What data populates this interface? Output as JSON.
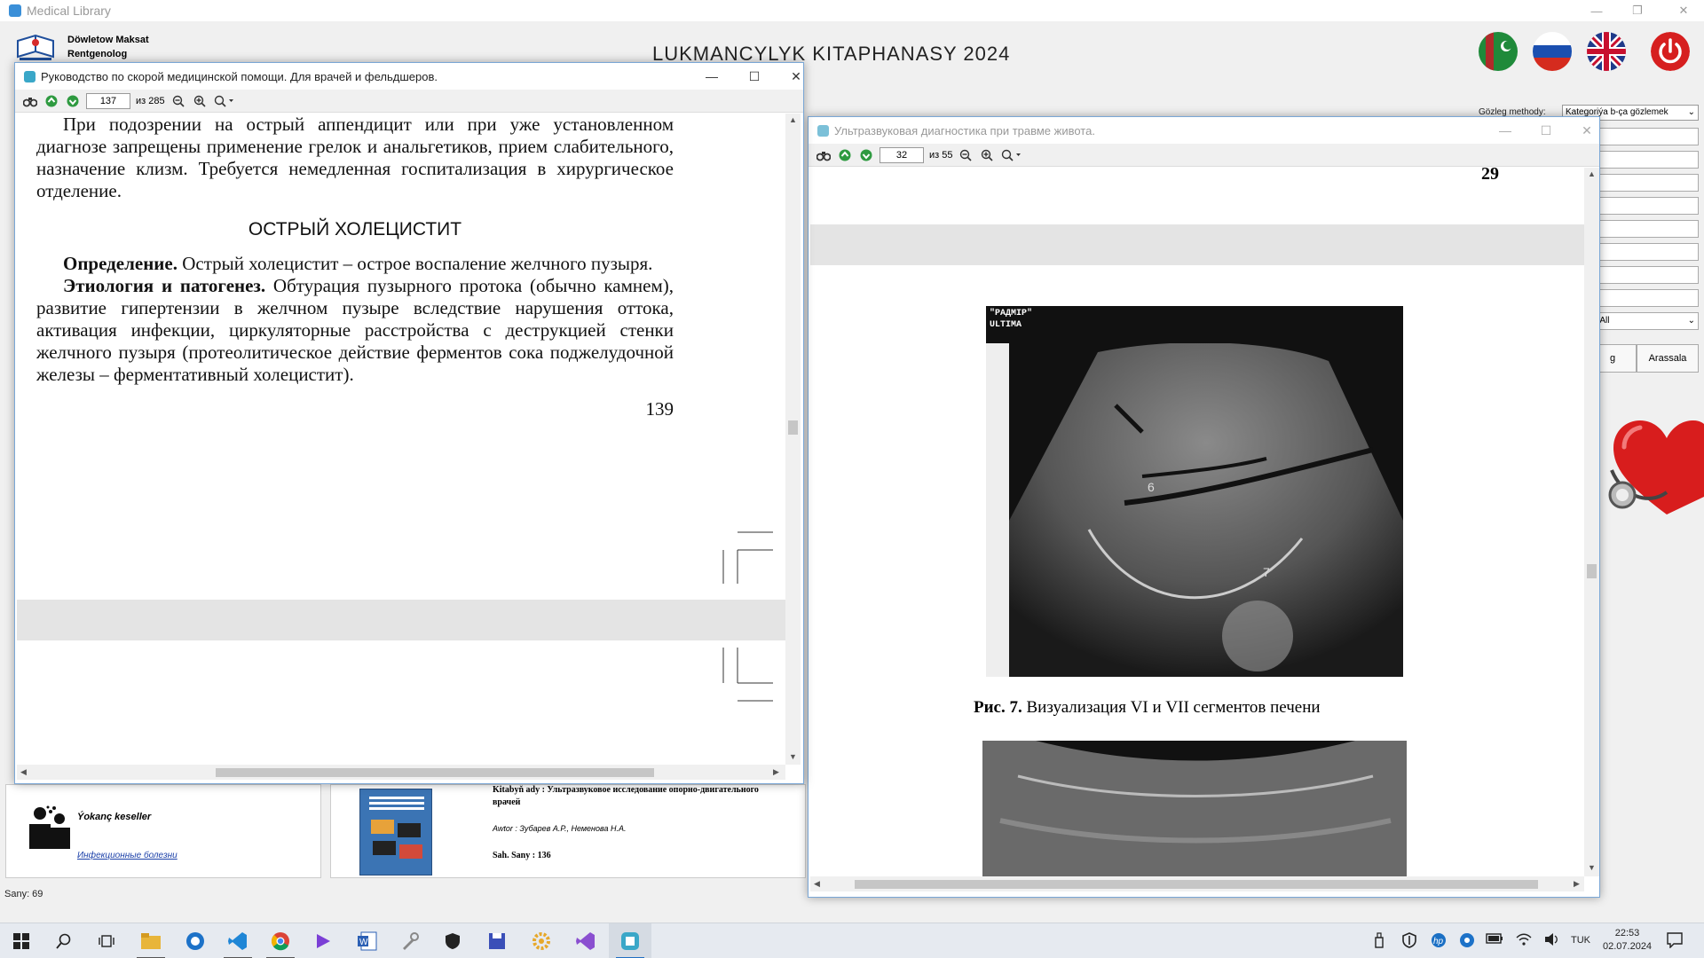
{
  "app": {
    "window_title": "Medical Library",
    "user_name": "Döwletow Maksat",
    "user_role": "Rentgenolog",
    "title": "LUKMANCYLYK KITAPHANASY 2024",
    "languages": [
      "turkmen-flag",
      "russian-flag",
      "english-flag"
    ],
    "filter_label": "Gözleg methody:",
    "filter_value": "Kategoriýa b-ça gözlemek",
    "lang_value": "e/All",
    "button_search_partial": "g",
    "button_clear": "Arassala",
    "count_label": "Sany: 69"
  },
  "category_card": {
    "title": "Ýokanç keseller",
    "subtitle": "Инфекционные болезни"
  },
  "book_card": {
    "title": "Kitabyň ady : Ультразвуковое исследование опорно-двигательного",
    "title_cont": "врачей",
    "author": "Awtor : Зубарев А.Р., Неменова Н.А.",
    "pages": "Sah. Sany : 136"
  },
  "doc1": {
    "title": "Руководство по скорой медицинской помощи. Для врачей и фельдшеров.",
    "page": "137",
    "of_pages": "из 285",
    "text_para1": "При подозрении на острый аппендицит или при уже установленном диагнозе запрещены применение грелок и анальгетиков, прием слабительного, назначение клизм. Требуется немедленная госпитализация в хирургическое отделение.",
    "heading": "ОСТРЫЙ ХОЛЕЦИСТИТ",
    "def_label": "Определение.",
    "def_text": " Острый холецистит – острое воспаление желчного пузыря.",
    "etio_label": "Этиология и патогенез.",
    "etio_text": " Обтурация пузырного протока (обычно камнем), развитие гипертензии в желчном пузыре вследствие нарушения оттока, активация инфекции, циркуляторные расстройства с деструкцией стенки желчного пузыря (протеолитическое действие ферментов сока поджелудочной железы – ферментативный холецистит).",
    "page_number": "139"
  },
  "doc2": {
    "title": "Ультразвуковая диагностика при травме живота.",
    "page": "32",
    "of_pages": "из 55",
    "page_number": "29",
    "image_label_top": "\"РАДМIР\"",
    "image_label_bottom": "ULTIMA",
    "marker_6": "6",
    "marker_7": "7",
    "caption_label": "Рис. 7.",
    "caption_text": " Визуализация VI и VII сегментов печени"
  },
  "taskbar": {
    "lang": "TUK",
    "time": "22:53",
    "date": "02.07.2024"
  }
}
